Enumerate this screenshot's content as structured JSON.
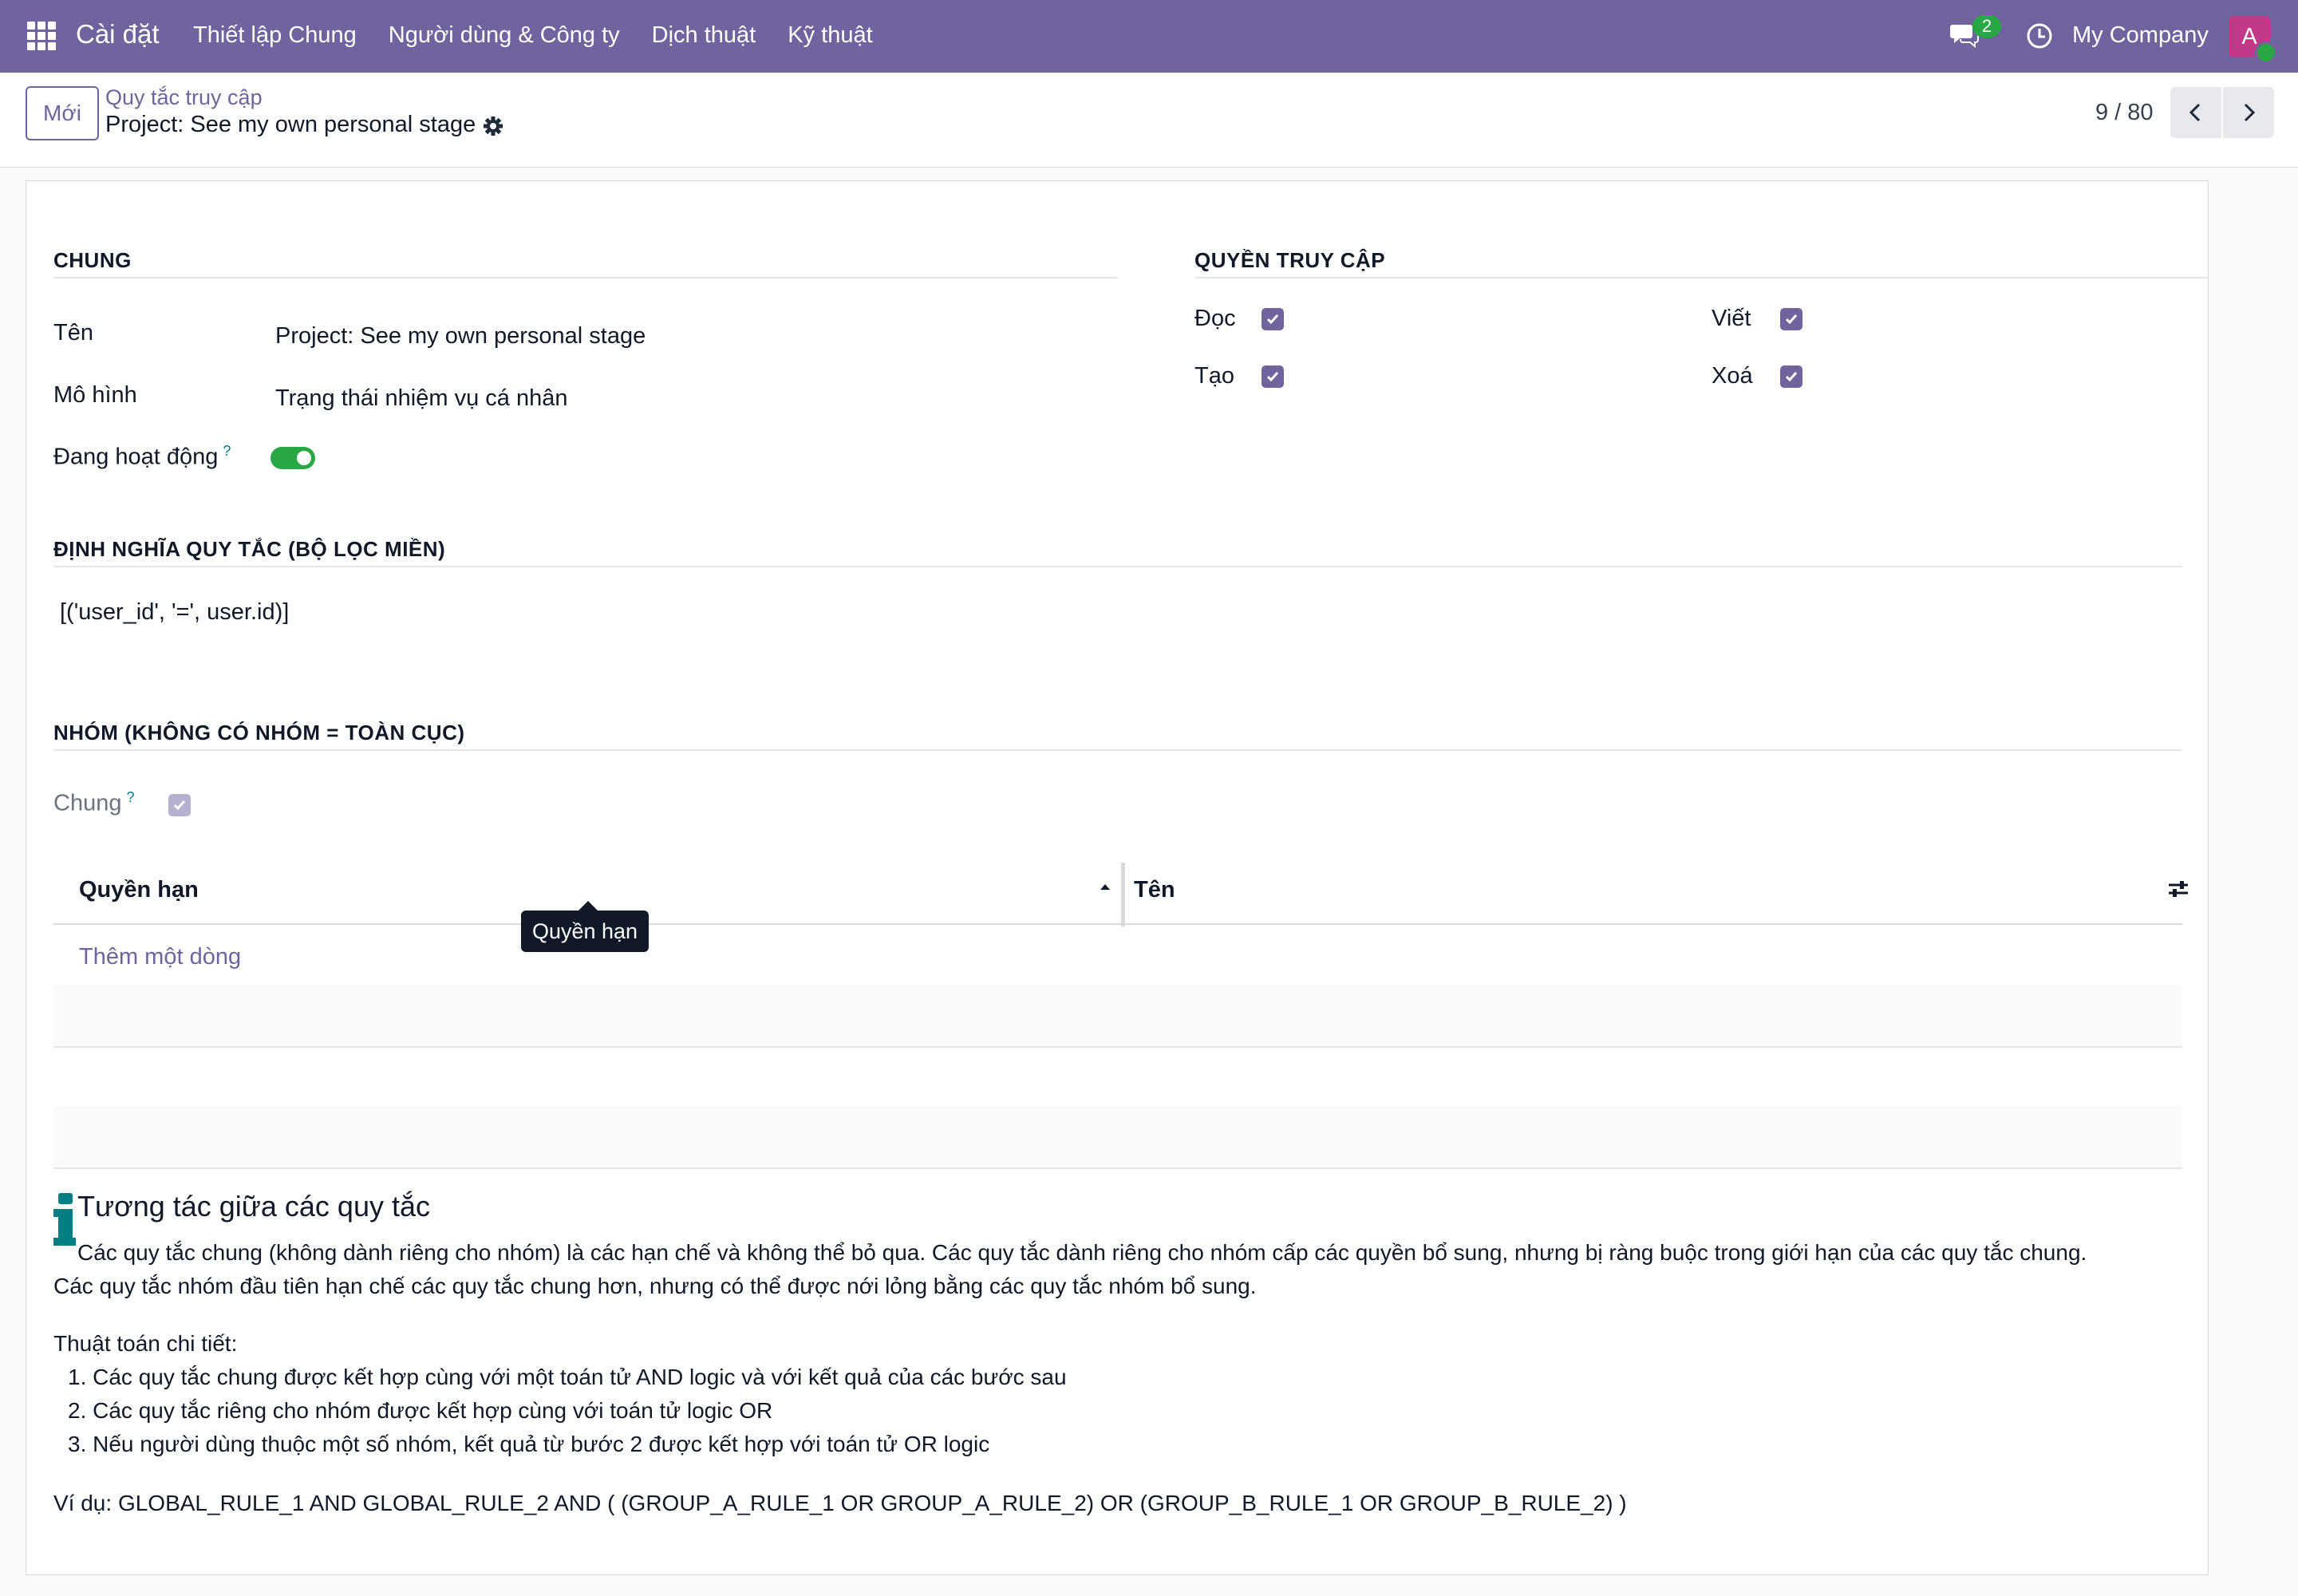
{
  "navbar": {
    "brand": "Cài đặt",
    "menu": [
      "Thiết lập Chung",
      "Người dùng & Công ty",
      "Dịch thuật",
      "Kỹ thuật"
    ],
    "messages_count": "2",
    "company": "My Company",
    "avatar_letter": "A",
    "color": "#71639e"
  },
  "control_panel": {
    "new_button": "Mới",
    "breadcrumb": "Quy tắc truy cập",
    "record_title": "Project: See my own personal stage",
    "pager": "9 / 80"
  },
  "general": {
    "section_title": "CHUNG",
    "name_label": "Tên",
    "name_value": "Project: See my own personal stage",
    "model_label": "Mô hình",
    "model_value": "Trạng thái nhiệm vụ cá nhân",
    "active_label": "Đang hoạt động",
    "active_help": "?",
    "active": true
  },
  "access": {
    "section_title": "QUYỀN TRUY CẬP",
    "read_label": "Đọc",
    "write_label": "Viết",
    "create_label": "Tạo",
    "delete_label": "Xoá",
    "read": true,
    "write": true,
    "create": true,
    "delete": true
  },
  "domain": {
    "section_title": "ĐỊNH NGHĨA QUY TẮC (BỘ LỌC MIỀN)",
    "value": "[('user_id', '=', user.id)]"
  },
  "groups": {
    "section_title": "NHÓM (KHÔNG CÓ NHÓM = TOÀN CỤC)",
    "global_label": "Chung",
    "global_help": "?",
    "global": true,
    "col_permission": "Quyền hạn",
    "col_name": "Tên",
    "add_line": "Thêm một dòng",
    "tooltip": "Quyền hạn"
  },
  "info": {
    "title": "Tương tác giữa các quy tắc",
    "para1_line1": "Các quy tắc chung (không dành riêng cho nhóm) là các hạn chế và không thể bỏ qua. Các quy tắc dành riêng cho nhóm cấp các quyền bổ sung, nhưng bị ràng buộc trong giới hạn của các quy tắc chung.",
    "para1_line2": "Các quy tắc nhóm đầu tiên hạn chế các quy tắc chung hơn, nhưng có thể được nới lỏng bằng các quy tắc nhóm bổ sung.",
    "algo_title": "Thuật toán chi tiết:",
    "steps": [
      "1. Các quy tắc chung được kết hợp cùng với một toán tử AND logic và với kết quả của các bước sau",
      "2. Các quy tắc riêng cho nhóm được kết hợp cùng với toán tử logic OR",
      "3. Nếu người dùng thuộc một số nhóm, kết quả từ bước 2 được kết hợp với toán tử OR logic"
    ],
    "example": "Ví dụ: GLOBAL_RULE_1 AND GLOBAL_RULE_2 AND ( (GROUP_A_RULE_1 OR GROUP_A_RULE_2) OR (GROUP_B_RULE_1 OR GROUP_B_RULE_2) )"
  }
}
